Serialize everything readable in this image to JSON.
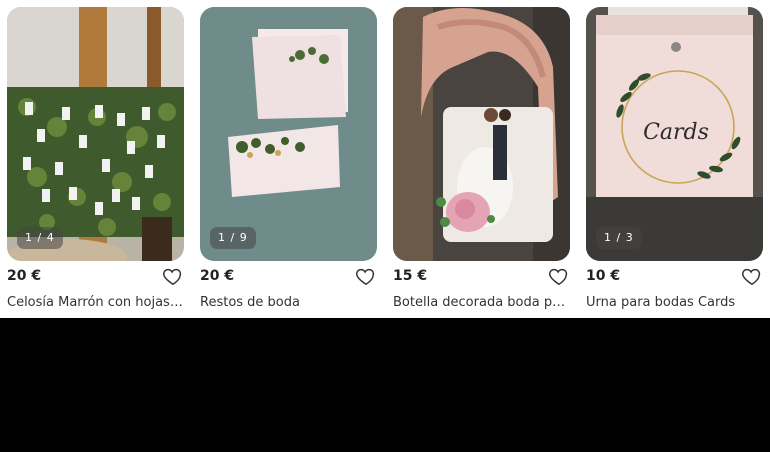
{
  "listings": [
    {
      "price": "20 €",
      "title": "Celosía Marrón con hojas ...",
      "pager": "1 / 4",
      "favorite_icon": "heart-outline-icon"
    },
    {
      "price": "20 €",
      "title": "Restos de boda",
      "pager": "1 / 9",
      "favorite_icon": "heart-outline-icon"
    },
    {
      "price": "15 €",
      "title": "Botella decorada boda pa...",
      "pager": "",
      "favorite_icon": "heart-outline-icon"
    },
    {
      "price": "10 €",
      "title": "Urna para bodas Cards",
      "pager": "1 / 3",
      "favorite_icon": "heart-outline-icon"
    }
  ],
  "photo_text": {
    "urn_sign": "Cards"
  },
  "colors": {
    "page_background": "#ffffff",
    "lower_area": "#000000",
    "text": "#222222"
  }
}
